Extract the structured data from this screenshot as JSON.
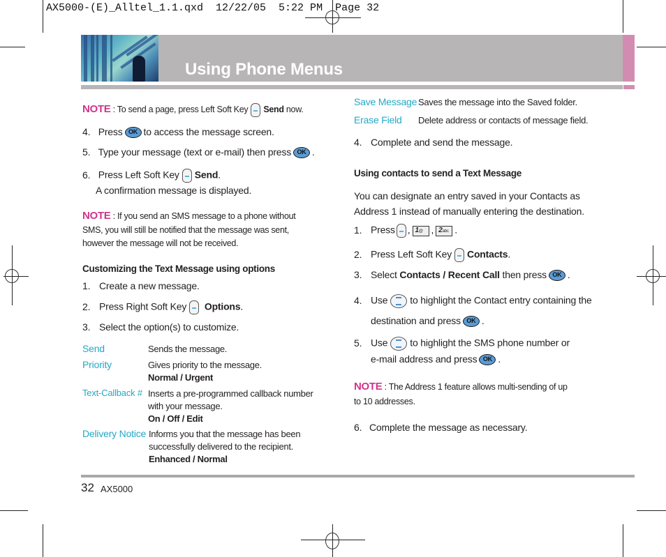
{
  "slug": "AX5000-(E)_Alltel_1.1.qxd  12/22/05  5:22 PM  Page 32",
  "header": {
    "title": "Using Phone Menus"
  },
  "colors": {
    "note": "#d0338a",
    "option": "#23a9c6",
    "band": "#b7b5b6",
    "accent_pink": "#d38cb1",
    "ok_button": "#5b9bd5"
  },
  "icons": {
    "ok": "OK",
    "key1": "1",
    "key1_sub": "@",
    "key2": "2",
    "key2_sub": "abc"
  },
  "left": {
    "note1": {
      "label": "NOTE",
      "text": ": To send a page, press Left Soft Key",
      "bold": "Send",
      "tail": "now."
    },
    "steps_a": [
      {
        "num": "4.",
        "pre": "Press",
        "post": "to access the message screen."
      },
      {
        "num": "5.",
        "pre": "Type your message (text or e-mail) then press",
        "post": "."
      },
      {
        "num": "6.",
        "pre": "Press Left Soft Key",
        "bold": "Send",
        "post": ".",
        "line2": "A confirmation message is displayed."
      }
    ],
    "note2": {
      "label": "NOTE",
      "line1": ": If you send an SMS message to a phone without",
      "line2": "SMS, you will still be notified that the message was sent,",
      "line3": "however the message will not be received."
    },
    "heading": "Customizing the Text Message using options",
    "steps_b": [
      {
        "num": "1.",
        "text": "Create a new message."
      },
      {
        "num": "2.",
        "pre": "Press Right Soft Key",
        "bold": "Options",
        "post": "."
      },
      {
        "num": "3.",
        "text": "Select the option(s) to customize."
      }
    ],
    "options": [
      {
        "label": "Send",
        "desc": "Sends the message."
      },
      {
        "label": "Priority",
        "desc": "Gives priority to the message.",
        "values": "Normal / Urgent"
      },
      {
        "label": "Text-Callback #",
        "desc1": "Inserts a pre-programmed callback number",
        "desc2": "with your message.",
        "values": "On / Off / Edit"
      },
      {
        "label": "Delivery Notice",
        "desc1": "Informs you that the message has been",
        "desc2": "successfully delivered to the recipient.",
        "values": "Enhanced / Normal"
      }
    ]
  },
  "right": {
    "options": [
      {
        "label": "Save Message",
        "desc": "Saves the message into the Saved folder."
      },
      {
        "label": "Erase Field",
        "desc": "Delete address or contacts of message field."
      }
    ],
    "step4": {
      "num": "4.",
      "text": "Complete and send the message."
    },
    "heading": "Using contacts to send a Text Message",
    "intro1": "You can designate an entry saved in your Contacts as",
    "intro2": "Address 1 instead of manually entering the destination.",
    "steps": [
      {
        "num": "1.",
        "pre": "Press",
        "sep1": ",",
        "sep2": ",",
        "post": "."
      },
      {
        "num": "2.",
        "pre": "Press Left Soft Key",
        "bold": "Contacts",
        "post": "."
      },
      {
        "num": "3.",
        "pre": "Select",
        "bold": "Contacts / Recent Call",
        "mid": "then press",
        "post": "."
      },
      {
        "num": "4.",
        "pre": "Use",
        "mid": "to highlight the Contact entry containing the",
        "line2": "destination and press",
        "post": "."
      },
      {
        "num": "5.",
        "pre": "Use",
        "mid": "to highlight the SMS phone number or",
        "line2": "e-mail address and press",
        "post": "."
      }
    ],
    "note": {
      "label": "NOTE",
      "line1": ": The Address 1 feature allows multi-sending of up",
      "line2": "to 10 addresses."
    },
    "step6": {
      "num": "6.",
      "text": "Complete the message as necessary."
    }
  },
  "footer": {
    "page_number": "32",
    "model": "AX5000"
  }
}
